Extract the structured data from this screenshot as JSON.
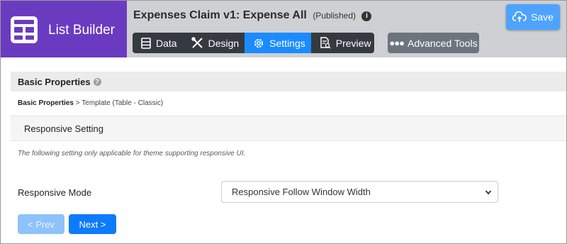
{
  "brand": {
    "title": "List Builder",
    "color": "#6a3bc0"
  },
  "header": {
    "title": "Expenses Claim v1: Expense All",
    "status": "(Published)",
    "info_icon": "info-circle-icon"
  },
  "tabs": [
    {
      "label": "Data",
      "icon": "table-icon",
      "active": false
    },
    {
      "label": "Design",
      "icon": "design-tools-icon",
      "active": false
    },
    {
      "label": "Settings",
      "icon": "gear-icon",
      "active": true
    },
    {
      "label": "Preview",
      "icon": "document-preview-icon",
      "active": false
    }
  ],
  "advanced_tools": {
    "label": "Advanced Tools",
    "icon": "ellipsis-icon"
  },
  "save": {
    "label": "Save",
    "icon": "cloud-upload-icon",
    "color": "#4da3ff"
  },
  "section": {
    "title": "Basic Properties",
    "help_icon": "question-circle-icon"
  },
  "breadcrumb": {
    "first": "Basic Properties",
    "separator": ">",
    "current": "Template (Table - Classic)"
  },
  "subsection": {
    "title": "Responsive Setting"
  },
  "note": "The following setting only applicable for theme supporting responsive UI.",
  "form": {
    "responsive_mode_label": "Responsive Mode",
    "responsive_mode_value": "Responsive Follow Window Width"
  },
  "navigation": {
    "prev_label": "< Prev",
    "next_label": "Next >",
    "prev_disabled": true
  },
  "colors": {
    "active_tab": "#1a8cff",
    "next_button": "#0d7bfb",
    "prev_button_disabled": "#8ec2fb"
  }
}
